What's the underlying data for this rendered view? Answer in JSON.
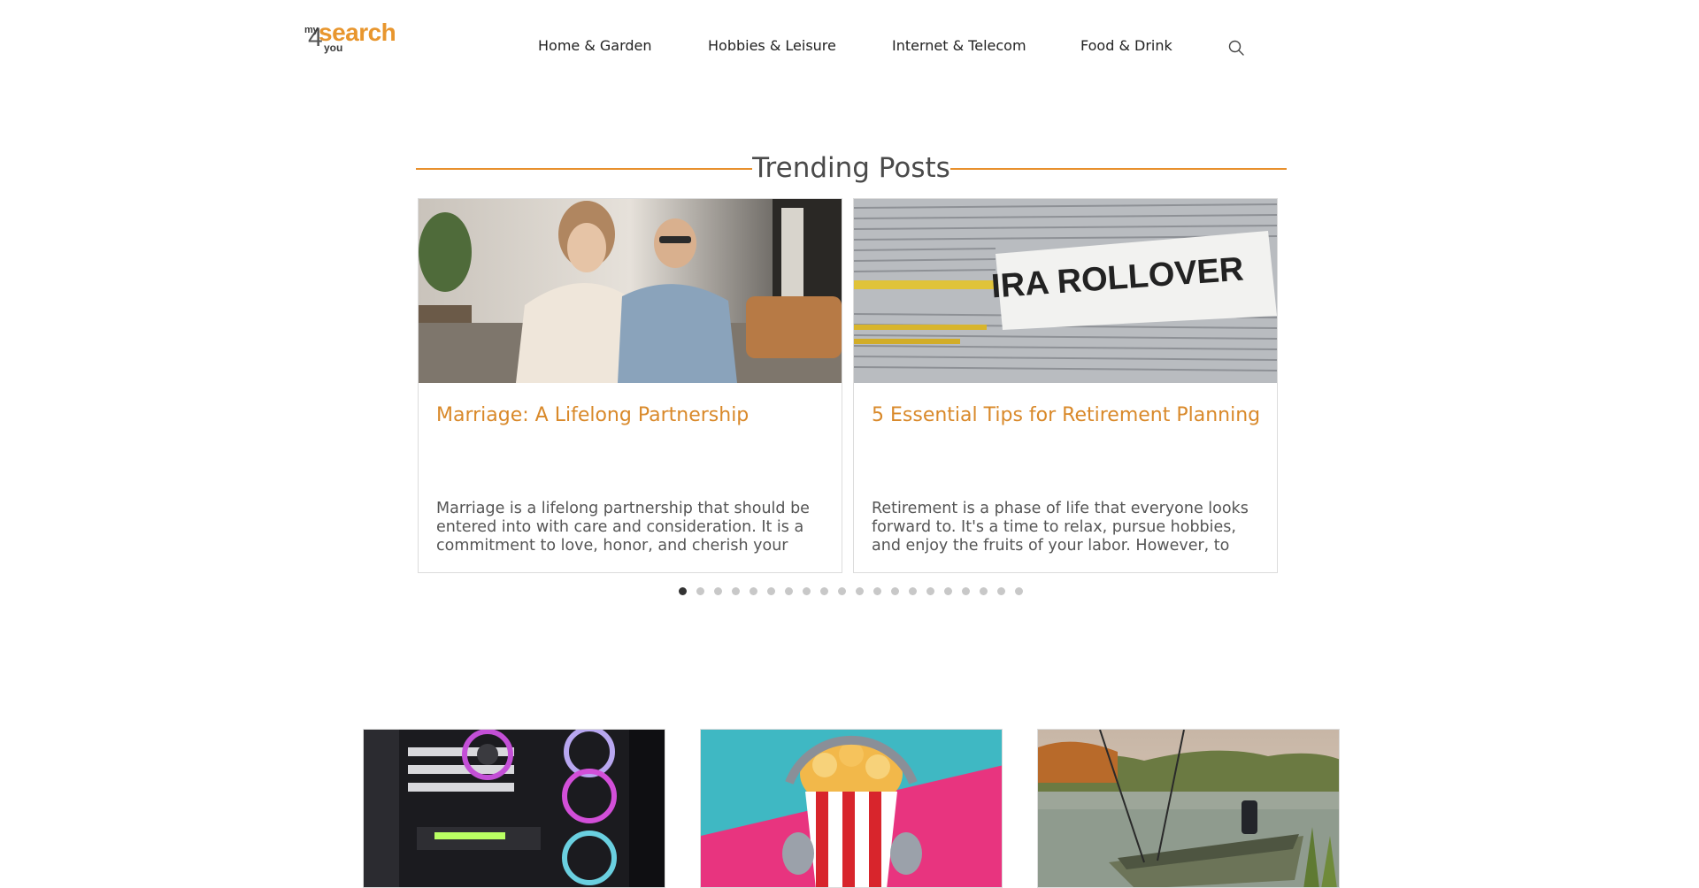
{
  "logo": {
    "my": "my",
    "four": "4",
    "search": "search",
    "you": "you"
  },
  "nav": {
    "items": [
      {
        "label": "Home & Garden"
      },
      {
        "label": "Hobbies & Leisure"
      },
      {
        "label": "Internet & Telecom"
      },
      {
        "label": "Food & Drink"
      }
    ],
    "search_icon": "search-icon"
  },
  "trending": {
    "title": "Trending Posts",
    "accent_color": "#e8902d",
    "posts": [
      {
        "title": "Marriage: A Lifelong Partnership",
        "excerpt": "Marriage is a lifelong partnership that should be entered into with care and consideration. It is a commitment to love, honor, and cherish your spous..."
      },
      {
        "title": "5 Essential Tips for Retirement Planning",
        "excerpt": "Retirement is a phase of life that everyone looks forward to. It's a time to relax, pursue hobbies, and enjoy the fruits of your labor. However, to ensure a...",
        "image_label": "IRA ROLLOVER"
      }
    ],
    "slide_count": 20,
    "active_slide": 1
  },
  "colors": {
    "title_orange": "#d9892a",
    "logo_orange": "#e8962e"
  }
}
